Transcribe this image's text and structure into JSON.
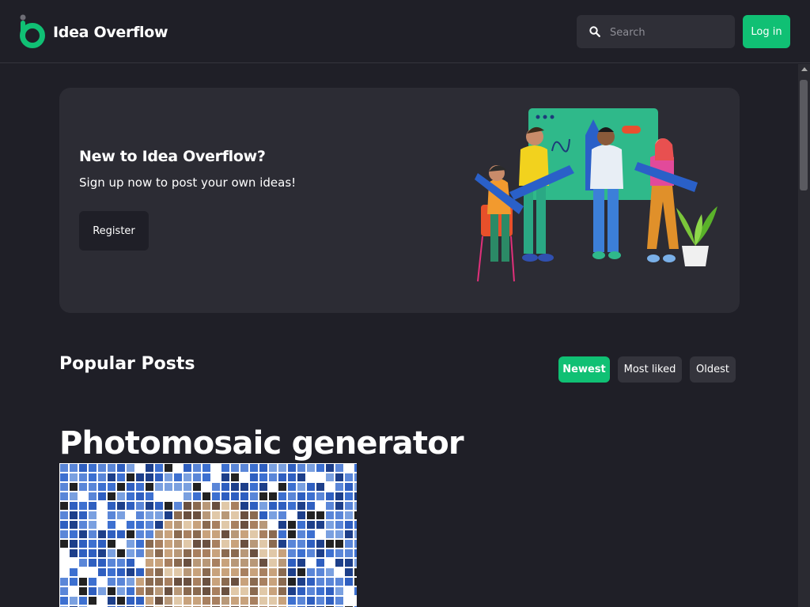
{
  "header": {
    "brand": "Idea Overflow",
    "search_placeholder": "Search",
    "login_label": "Log in"
  },
  "hero": {
    "title": "New to Idea Overflow?",
    "subtitle": "Sign up now to post your own ideas!",
    "register_label": "Register"
  },
  "posts": {
    "section_title": "Popular Posts",
    "sort_options": [
      {
        "label": "Newest",
        "active": true
      },
      {
        "label": "Most liked",
        "active": false
      },
      {
        "label": "Oldest",
        "active": false
      }
    ],
    "items": [
      {
        "title": "Photomosaic generator"
      }
    ]
  },
  "colors": {
    "background": "#1f1f27",
    "card": "#2c2c34",
    "accent": "#10c074",
    "input": "#2f2f37"
  },
  "icons": {
    "logo": "idea-overflow-logo",
    "search": "search-icon"
  }
}
